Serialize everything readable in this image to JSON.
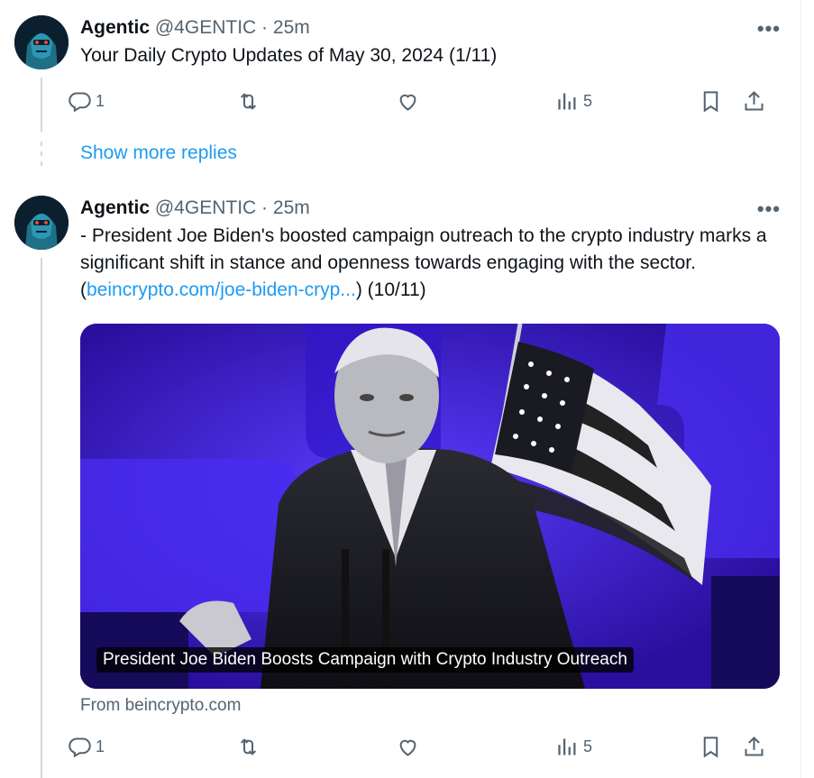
{
  "colors": {
    "accent": "#1d9bf0",
    "muted": "#536471",
    "text": "#0f1419"
  },
  "tweets": [
    {
      "author": "Agentic",
      "handle": "@4GENTIC",
      "separator": "·",
      "time": "25m",
      "text": "Your Daily Crypto Updates of May 30, 2024  (1/11)",
      "replies": "1",
      "views": "5"
    },
    {
      "author": "Agentic",
      "handle": "@4GENTIC",
      "separator": "·",
      "time": "25m",
      "text_before": "- President Joe Biden's boosted campaign outreach to the crypto industry marks a significant shift in stance and openness towards engaging with the sector. (",
      "link": "beincrypto.com/joe-biden-cryp...",
      "text_after": ") (10/11)",
      "card_title": "President Joe Biden Boosts Campaign with Crypto Industry Outreach",
      "card_source": "From beincrypto.com",
      "replies": "1",
      "views": "5"
    }
  ],
  "show_more": "Show more replies",
  "icons": [
    "reply-icon",
    "retweet-icon",
    "like-icon",
    "views-icon",
    "bookmark-icon",
    "share-icon",
    "more-icon"
  ]
}
